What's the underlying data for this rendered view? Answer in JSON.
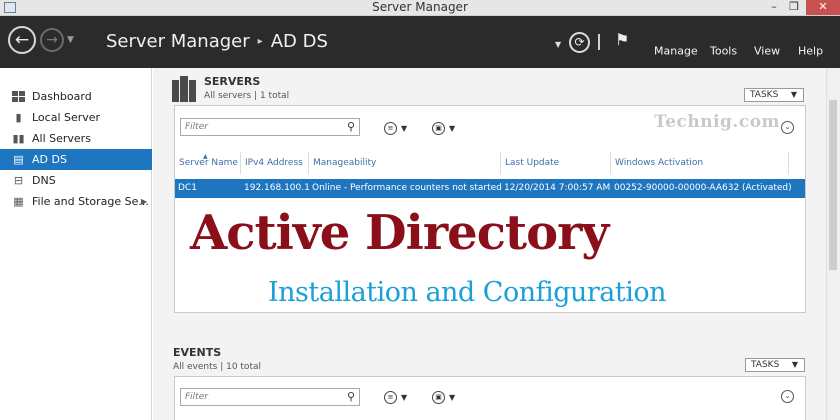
{
  "window": {
    "title": "Server Manager",
    "controls": {
      "minimize": "–",
      "maximize": "❐",
      "close": "✕"
    }
  },
  "header": {
    "nav": {
      "back": "←",
      "forward": "→",
      "history": "▼"
    },
    "breadcrumb": [
      "Server Manager",
      "AD DS"
    ],
    "separator": "▸",
    "icons": {
      "dropdown": "▼",
      "refresh": "⟳",
      "flag": "⚑"
    },
    "menu": [
      "Manage",
      "Tools",
      "View",
      "Help"
    ]
  },
  "sidebar": {
    "items": [
      {
        "label": "Dashboard",
        "icon": "dashboard-icon",
        "selected": false
      },
      {
        "label": "Local Server",
        "icon": "server-icon",
        "selected": false
      },
      {
        "label": "All Servers",
        "icon": "servers-icon",
        "selected": false
      },
      {
        "label": "AD DS",
        "icon": "directory-icon",
        "selected": true
      },
      {
        "label": "DNS",
        "icon": "dns-icon",
        "selected": false
      },
      {
        "label": "File and Storage Se...",
        "icon": "storage-icon",
        "selected": false,
        "expand": "▶"
      }
    ]
  },
  "servers": {
    "title": "SERVERS",
    "subtitle": "All servers | 1 total",
    "tasks": "TASKS",
    "filter_placeholder": "Filter",
    "columns": [
      "Server Name",
      "IPv4 Address",
      "Manageability",
      "Last Update",
      "Windows Activation"
    ],
    "rows": [
      {
        "server_name": "DC1",
        "ipv4": "192.168.100.1",
        "manageability": "Online - Performance counters not started",
        "last_update": "12/20/2014 7:00:57 AM",
        "activation": "00252-90000-00000-AA632 (Activated)"
      }
    ]
  },
  "events": {
    "title": "EVENTS",
    "subtitle": "All events | 10 total",
    "tasks": "TASKS",
    "filter_placeholder": "Filter"
  },
  "glyphs": {
    "search": "⚲",
    "list": "≡",
    "save": "▣",
    "caret": "▼",
    "expand": "⌄",
    "sort": "▲"
  },
  "overlay": {
    "watermark": "Technig.com",
    "title": "Active Directory",
    "subtitle": "Installation and Configuration"
  },
  "colors": {
    "header_bg": "#2b2b2b",
    "selection": "#1e76c0",
    "title_red": "#8b0f1a",
    "subtitle_blue": "#1aa0d8"
  }
}
